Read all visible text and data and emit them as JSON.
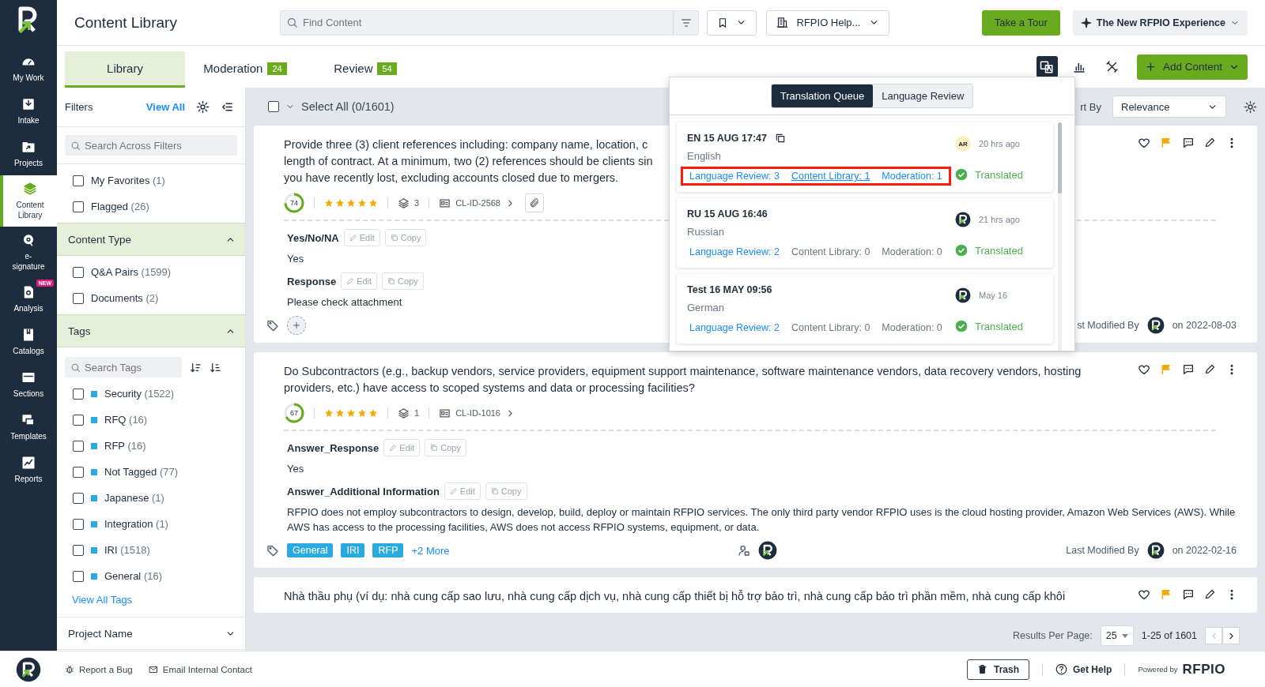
{
  "nav": {
    "items": [
      {
        "label": "My Work",
        "selected": false
      },
      {
        "label": "Intake",
        "selected": false
      },
      {
        "label": "Projects",
        "selected": false
      },
      {
        "label": "Content Library",
        "selected": true
      },
      {
        "label": "e-signature",
        "selected": false
      },
      {
        "label": "Analysis",
        "badge": "NEW",
        "selected": false
      },
      {
        "label": "Catalogs",
        "selected": false
      },
      {
        "label": "Sections",
        "selected": false
      },
      {
        "label": "Templates",
        "selected": false
      },
      {
        "label": "Reports",
        "selected": false
      }
    ]
  },
  "header": {
    "title": "Content Library",
    "search": {
      "placeholder": "Find Content"
    },
    "workspace": "RFPIO Help...",
    "tour_button": "Take a Tour",
    "experience_button": "The New RFPIO Experience"
  },
  "tabs": [
    {
      "label": "Library",
      "selected": true
    },
    {
      "label": "Moderation",
      "count": "24",
      "selected": false
    },
    {
      "label": "Review",
      "count": "54",
      "selected": false
    }
  ],
  "toolbar": {
    "translation_selected": true,
    "add_button": "Add Content"
  },
  "filters": {
    "title": "Filters",
    "view_all": "View All",
    "search": {
      "placeholder": "Search Across Filters"
    },
    "quick": [
      {
        "label": "My Favorites",
        "count": "(1)",
        "checked": false
      },
      {
        "label": "Flagged",
        "count": "(26)",
        "checked": false
      }
    ],
    "sections": [
      {
        "kind": "options",
        "title": "Content Type",
        "expanded": true,
        "options": [
          {
            "label": "Q&A Pairs",
            "count": "(1599)",
            "checked": false
          },
          {
            "label": "Documents",
            "count": "(2)",
            "checked": false
          }
        ]
      },
      {
        "kind": "tags",
        "title": "Tags",
        "expanded": true,
        "search": {
          "placeholder": "Search Tags"
        },
        "options": [
          {
            "label": "Security",
            "count": "(1522)",
            "checked": false
          },
          {
            "label": "RFQ",
            "count": "(16)",
            "checked": false
          },
          {
            "label": "RFP",
            "count": "(16)",
            "checked": false
          },
          {
            "label": "Not Tagged",
            "count": "(77)",
            "checked": false
          },
          {
            "label": "Japanese",
            "count": "(1)",
            "checked": false
          },
          {
            "label": "Integration",
            "count": "(1)",
            "checked": false
          },
          {
            "label": "IRI",
            "count": "(1518)",
            "checked": false
          },
          {
            "label": "General",
            "count": "(16)",
            "checked": false
          }
        ],
        "view_all": "View All Tags"
      },
      {
        "kind": "options",
        "title": "Project Name",
        "expanded": false
      }
    ]
  },
  "list": {
    "select_all": "Select All (0/1601)",
    "select_all_checked": false,
    "sort_label": "rt By",
    "sort_value": "Relevance"
  },
  "cards": [
    {
      "question_lines": [
        "Provide three (3) client references including: company name, location, c",
        "length of contract. At a minimum, two (2) references should be clients sin",
        "you have recently lost, excluding accounts closed due to mergers."
      ],
      "score": "74",
      "stars": 5,
      "versions": "3",
      "content_id": "CL-ID-2568",
      "attachment": true,
      "favorite": false,
      "flagged": true,
      "answers": [
        {
          "label": "Yes/No/NA",
          "edit": "Edit",
          "copy": "Copy",
          "text": "Yes"
        },
        {
          "label": "Response",
          "edit": "Edit",
          "copy": "Copy",
          "text": "Please check attachment"
        }
      ],
      "add_tag": true,
      "modified_label": "st Modified By",
      "modified_date": "on 2022-08-03"
    },
    {
      "question": "Do Subcontractors (e.g., backup vendors, service providers, equipment support maintenance, software maintenance vendors, data recovery vendors, hosting providers, etc.) have access to scoped systems and data or processing facilities?",
      "score": "67",
      "stars": 5,
      "versions": "1",
      "content_id": "CL-ID-1016",
      "attachment": false,
      "favorite": false,
      "flagged": true,
      "answers": [
        {
          "label": "Answer_Response",
          "edit": "Edit",
          "copy": "Copy",
          "text": "Yes"
        },
        {
          "label": "Answer_Additional Information",
          "edit": "Edit",
          "copy": "Copy",
          "text": "RFPIO does not employ subcontractors to design, develop, build, deploy or maintain RFPIO services. The only third party vendor RFPIO uses is the cloud hosting provider, Amazon Web Services (AWS). While AWS has access to the processing facilities, AWS does not access RFPIO systems, equipment, or data."
        }
      ],
      "tags": [
        "General",
        "IRI",
        "RFP"
      ],
      "more_tags": "+2 More",
      "owner": true,
      "modified_label": "Last Modified By",
      "modified_date": "on 2022-02-16"
    },
    {
      "question_lines": [
        "Nhà thầu phụ (ví dụ: nhà cung cấp sao lưu, nhà cung cấp dịch vụ, nhà cung cấp thiết bị hỗ trợ bảo trì, nhà cung cấp bảo trì phần mềm, nhà cung cấp khôi"
      ],
      "favorite": false,
      "flagged": true
    }
  ],
  "pagination": {
    "label": "Results Per Page:",
    "per_page": "25",
    "range": "1-25 of 1601",
    "prev_disabled": true
  },
  "popup": {
    "tabs": [
      {
        "label": "Translation Queue",
        "selected": true
      },
      {
        "label": "Language Review",
        "selected": false
      }
    ],
    "items": [
      {
        "title": "EN 15 AUG 17:47",
        "copy_icon": true,
        "language": "English",
        "avatar": {
          "kind": "initials",
          "text": "AR"
        },
        "time": "20 hrs ago",
        "highlighted": true,
        "links": [
          {
            "label": "Language Review: 3",
            "active": true,
            "underlined": false
          },
          {
            "label": "Content Library: 1",
            "active": true,
            "underlined": true
          },
          {
            "label": "Moderation: 1",
            "active": true,
            "underlined": false
          }
        ],
        "status": "Translated"
      },
      {
        "title": "RU 15 AUG 16:46",
        "copy_icon": false,
        "language": "Russian",
        "avatar": {
          "kind": "logo"
        },
        "time": "21 hrs ago",
        "highlighted": false,
        "links": [
          {
            "label": "Language Review: 2",
            "active": true,
            "underlined": false
          },
          {
            "label": "Content Library: 0",
            "active": false,
            "underlined": false
          },
          {
            "label": "Moderation: 0",
            "active": false,
            "underlined": false
          }
        ],
        "status": "Translated"
      },
      {
        "title": "Test 16 MAY 09:56",
        "copy_icon": false,
        "language": "German",
        "avatar": {
          "kind": "logo"
        },
        "time": "May 16",
        "highlighted": false,
        "links": [
          {
            "label": "Language Review: 2",
            "active": true,
            "underlined": false
          },
          {
            "label": "Content Library: 0",
            "active": false,
            "underlined": false
          },
          {
            "label": "Moderation: 0",
            "active": false,
            "underlined": false
          }
        ],
        "status": "Translated"
      }
    ]
  },
  "footer": {
    "links": [
      "Report a Bug",
      "Email Internal Contact"
    ],
    "trash": "Trash",
    "help": "Get Help",
    "powered": "Powered by",
    "brand": "RFPIO"
  }
}
